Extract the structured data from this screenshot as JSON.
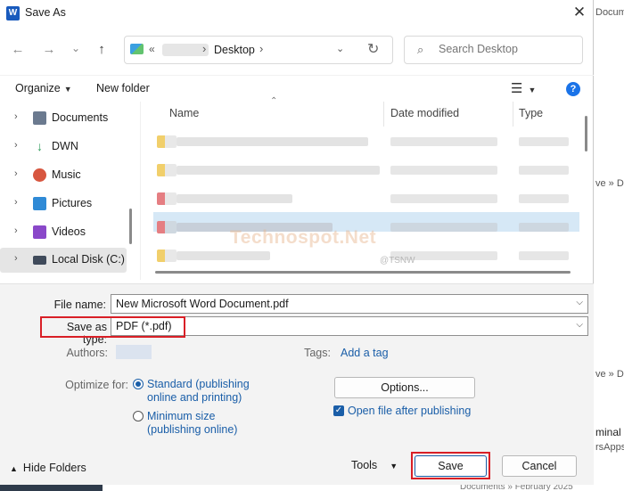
{
  "window": {
    "title": "Save As",
    "app_icon": "W",
    "close_icon": "✕"
  },
  "navigation": {
    "back_icon": "←",
    "forward_icon": "→",
    "recent_icon": "⌄",
    "up_icon": "↑"
  },
  "address_bar": {
    "overflow_chevron": "«",
    "current_folder": "Desktop",
    "separator": "›"
  },
  "search": {
    "placeholder": "Search Desktop"
  },
  "toolbar": {
    "organize_label": "Organize",
    "new_folder_label": "New folder",
    "help_label": "?"
  },
  "sidebar": {
    "items": [
      {
        "label": "Documents",
        "icon": "documents-icon",
        "color": "#6b7a8f"
      },
      {
        "label": "DWN",
        "icon": "download-icon",
        "color": "#2e9c5b"
      },
      {
        "label": "Music",
        "icon": "music-icon",
        "color": "#d7563f"
      },
      {
        "label": "Pictures",
        "icon": "pictures-icon",
        "color": "#2f8ad6"
      },
      {
        "label": "Videos",
        "icon": "videos-icon",
        "color": "#8a48c9"
      },
      {
        "label": "Local Disk (C:)",
        "icon": "drive-icon",
        "color": "#3f4a5a"
      }
    ]
  },
  "file_list": {
    "columns": [
      "Name",
      "Date modified",
      "Type"
    ],
    "watermark": "Technospot.Net",
    "watermark_sub": "@TSNW"
  },
  "form": {
    "file_name_label": "File name:",
    "file_name_value": "New Microsoft Word Document.pdf",
    "save_type_label": "Save as type:",
    "save_type_value": "PDF (*.pdf)",
    "authors_label": "Authors:",
    "tags_label": "Tags:",
    "tags_link": "Add a tag",
    "optimize_label": "Optimize for:",
    "standard_option_line1": "Standard (publishing",
    "standard_option_line2": "online and printing)",
    "minimum_option_line1": "Minimum size",
    "minimum_option_line2": "(publishing online)",
    "options_button": "Options...",
    "open_after_label": "Open file after publishing"
  },
  "footer": {
    "hide_folders_label": "Hide Folders",
    "tools_label": "Tools",
    "save_label": "Save",
    "cancel_label": "Cancel"
  },
  "background": {
    "snippets": [
      "Docum",
      "ve » De",
      "ve » De",
      "minal",
      "rsApps",
      "Documents » February 2025"
    ]
  },
  "colors": {
    "accent": "#1a5ea8",
    "highlight_red": "#d91f26"
  }
}
